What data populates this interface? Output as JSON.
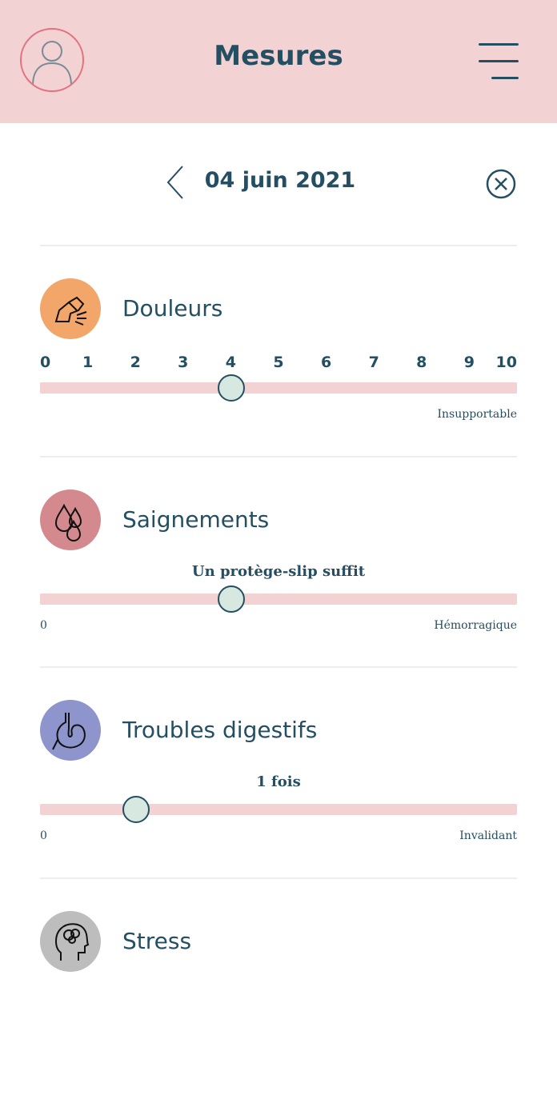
{
  "header": {
    "title": "Mesures",
    "background": "#f2d2d3",
    "avatar_icon": "user-avatar-icon",
    "menu_icon": "menu-icon"
  },
  "date_nav": {
    "date": "04 juin 2021",
    "prev_icon": "chevron-left-icon",
    "close_icon": "close-circle-icon"
  },
  "measures": [
    {
      "title": "Douleurs",
      "icon": "pain-icon",
      "icon_color": "#f2a66a",
      "ticks": [
        "0",
        "1",
        "2",
        "3",
        "4",
        "5",
        "6",
        "7",
        "8",
        "9",
        "10"
      ],
      "value": 4,
      "min": 0,
      "max": 10,
      "max_label": "Insupportable"
    },
    {
      "title": "Saignements",
      "icon": "blood-drops-icon",
      "icon_color": "#d3898d",
      "value_label": "Un protège-slip suffit",
      "value_fraction": 0.4,
      "min_label": "0",
      "max_label": "Hémorragique"
    },
    {
      "title": "Troubles digestifs",
      "icon": "stomach-icon",
      "icon_color": "#8e94cc",
      "value_label": "1 fois",
      "value_fraction": 0.2,
      "min_label": "0",
      "max_label": "Invalidant"
    },
    {
      "title": "Stress",
      "icon": "stress-head-icon",
      "icon_color": "#bdbdbd"
    }
  ],
  "colors": {
    "primary": "#244f63",
    "track": "#f2d2d3",
    "thumb": "#d6e8df",
    "avatar_border": "#e3717f"
  }
}
